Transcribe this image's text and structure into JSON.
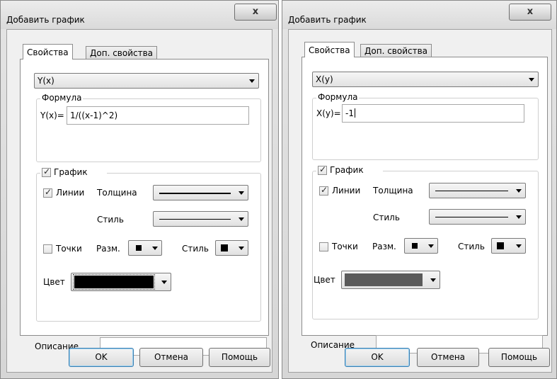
{
  "dialogs": [
    {
      "title": "Добавить график",
      "close": "x",
      "tabs": [
        "Свойства",
        "Доп. свойства"
      ],
      "function_type": "Y(x)",
      "formula_group": "Формула",
      "formula_prefix": "Y(x)=",
      "formula_value": "1/((x-1)^2)",
      "graph_group": "График",
      "graph_checked": true,
      "lines_label": "Линии",
      "lines_checked": true,
      "thickness_label": "Толщина",
      "style_label": "Стиль",
      "points_label": "Точки",
      "points_checked": false,
      "size_label": "Разм.",
      "points_style_label": "Стиль",
      "color_label": "Цвет",
      "color_value": "#000000",
      "description_label": "Описание",
      "description_value": "",
      "ok": "OK",
      "cancel": "Отмена",
      "help": "Помощь"
    },
    {
      "title": "Добавить график",
      "close": "x",
      "tabs": [
        "Свойства",
        "Доп. свойства"
      ],
      "function_type": "X(y)",
      "formula_group": "Формула",
      "formula_prefix": "X(y)=",
      "formula_value": "-1",
      "graph_group": "График",
      "graph_checked": true,
      "lines_label": "Линии",
      "lines_checked": true,
      "thickness_label": "Толщина",
      "style_label": "Стиль",
      "points_label": "Точки",
      "points_checked": false,
      "size_label": "Разм.",
      "points_style_label": "Стиль",
      "color_label": "Цвет",
      "color_value": "#5a5a5a",
      "description_label": "Описание",
      "description_value": "",
      "ok": "OK",
      "cancel": "Отмена",
      "help": "Помощь"
    }
  ]
}
